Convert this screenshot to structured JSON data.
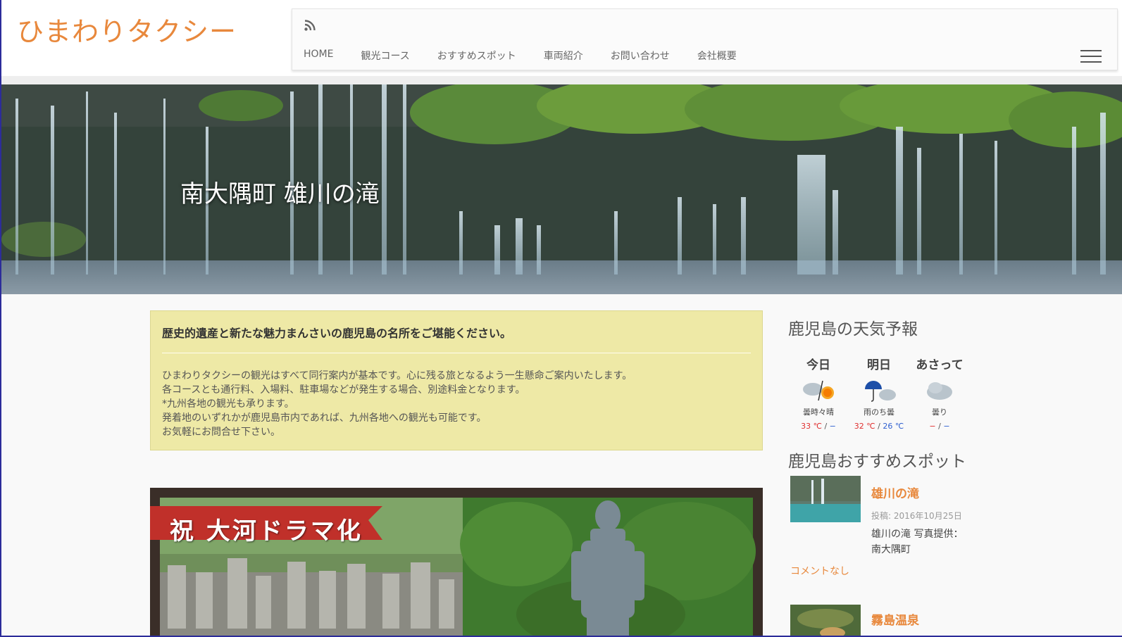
{
  "site": {
    "title": "ひまわりタクシー"
  },
  "nav": {
    "items": [
      {
        "label": "HOME"
      },
      {
        "label": "観光コース"
      },
      {
        "label": "おすすめスポット"
      },
      {
        "label": "車両紹介"
      },
      {
        "label": "お問い合わせ"
      },
      {
        "label": "会社概要"
      }
    ],
    "icons": [
      "rss-icon",
      "hamburger-menu-icon"
    ]
  },
  "hero": {
    "caption": "南大隅町 雄川の滝"
  },
  "notice": {
    "title": "歴史的遺産と新たな魅力まんさいの鹿児島の名所をご堪能ください。",
    "lines": [
      "ひまわりタクシーの観光はすべて同行案内が基本です。心に残る旅となるよう一生懸命ご案内いたします。",
      "各コースとも通行料、入場料、駐車場などが発生する場合、別途料金となります。",
      "*九州各地の観光も承ります。",
      "発着地のいずれかが鹿児島市内であれば、九州各地への観光も可能です。",
      "お気軽にお問合せ下さい。"
    ]
  },
  "promo": {
    "banner": "祝 大河ドラマ化"
  },
  "weather": {
    "title": "鹿児島の天気予報",
    "days": [
      {
        "name": "今日",
        "condition": "曇時々晴",
        "high": "33 ℃",
        "sep": " / ",
        "low": "−",
        "icon": "cloud-sun-icon"
      },
      {
        "name": "明日",
        "condition": "雨のち曇",
        "high": "32 ℃",
        "sep": " / ",
        "low": "26 ℃",
        "icon": "rain-cloud-icon"
      },
      {
        "name": "あさって",
        "condition": "曇り",
        "high": "−",
        "sep": " / ",
        "low": "−",
        "icon": "cloud-icon"
      }
    ]
  },
  "spots": {
    "title": "鹿児島おすすめスポット",
    "items": [
      {
        "title": "雄川の滝",
        "meta": "投稿: 2016年10月25日",
        "excerpt": "雄川の滝 写真提供：南大隅町",
        "comments": "コメントなし"
      },
      {
        "title": "霧島温泉"
      }
    ]
  },
  "colors": {
    "accent": "#e8883c",
    "notice_bg": "#eee9a6"
  }
}
